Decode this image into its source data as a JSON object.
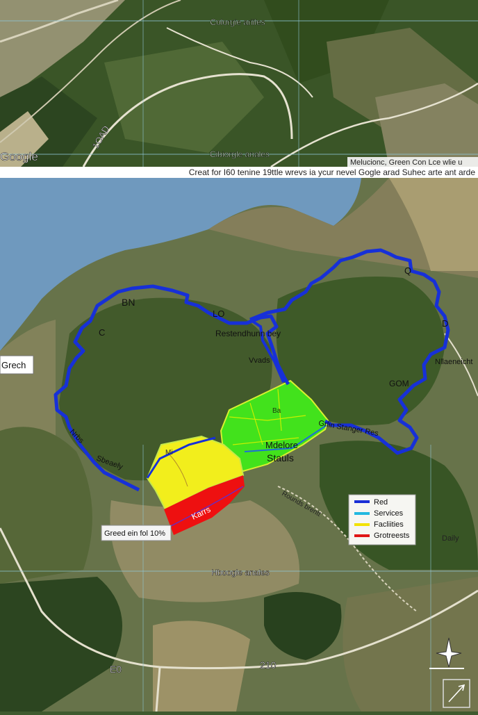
{
  "top_map": {
    "label_top": "Colorgie ariiles",
    "brand": "Google",
    "road_label": "1OAD",
    "label_bottom": "Cibiorgle anales"
  },
  "banner": {
    "caption": "Creat for I60 tenine 19ttle wrevs ia ycur nevel Gogle arad Suhec arte ant arde",
    "corner_note": "Melucionc, Green Con Lce wlie u"
  },
  "main_map": {
    "left_box": "Grech",
    "labels": {
      "bn": "BN",
      "lo": "LO",
      "c_left": "C",
      "q_right": "Q",
      "d_right": "D",
      "center_top": "Restendhunn bey",
      "wauds": "Vvads",
      "right_mid": "Nllaeneicht",
      "gom": "GOM",
      "route_right": "Grlin Stanger Res",
      "left_route": "Nrbs",
      "left_route2": "Sbeaely",
      "green_zone_small": "Ba",
      "green_zone_mid": "Mdelore",
      "green_zone_name": "Stauls",
      "yellow_zone_label": "Mi",
      "red_zone_label": "Karrs",
      "right_small": "Daily",
      "road_note": "Rounds brentt",
      "bottom_map_label": "Hboogle anales",
      "road_num_left": "E0",
      "road_num_mid": "210"
    },
    "callout": "Greed ein fol 10%",
    "legend": [
      {
        "label": "Red",
        "color": "#1a2fd6"
      },
      {
        "label": "Services",
        "color": "#22b8e0"
      },
      {
        "label": "Facliities",
        "color": "#f2e200"
      },
      {
        "label": "Grotreests",
        "color": "#e01616"
      }
    ],
    "colors": {
      "boundary": "#1730d8",
      "green_zone": "#3fe21a",
      "yellow_zone": "#f0ec1a",
      "red_zone": "#ee1010",
      "water": "#6f9fc6"
    },
    "icons": [
      "north-arrow-icon",
      "compass-rose-icon"
    ]
  }
}
